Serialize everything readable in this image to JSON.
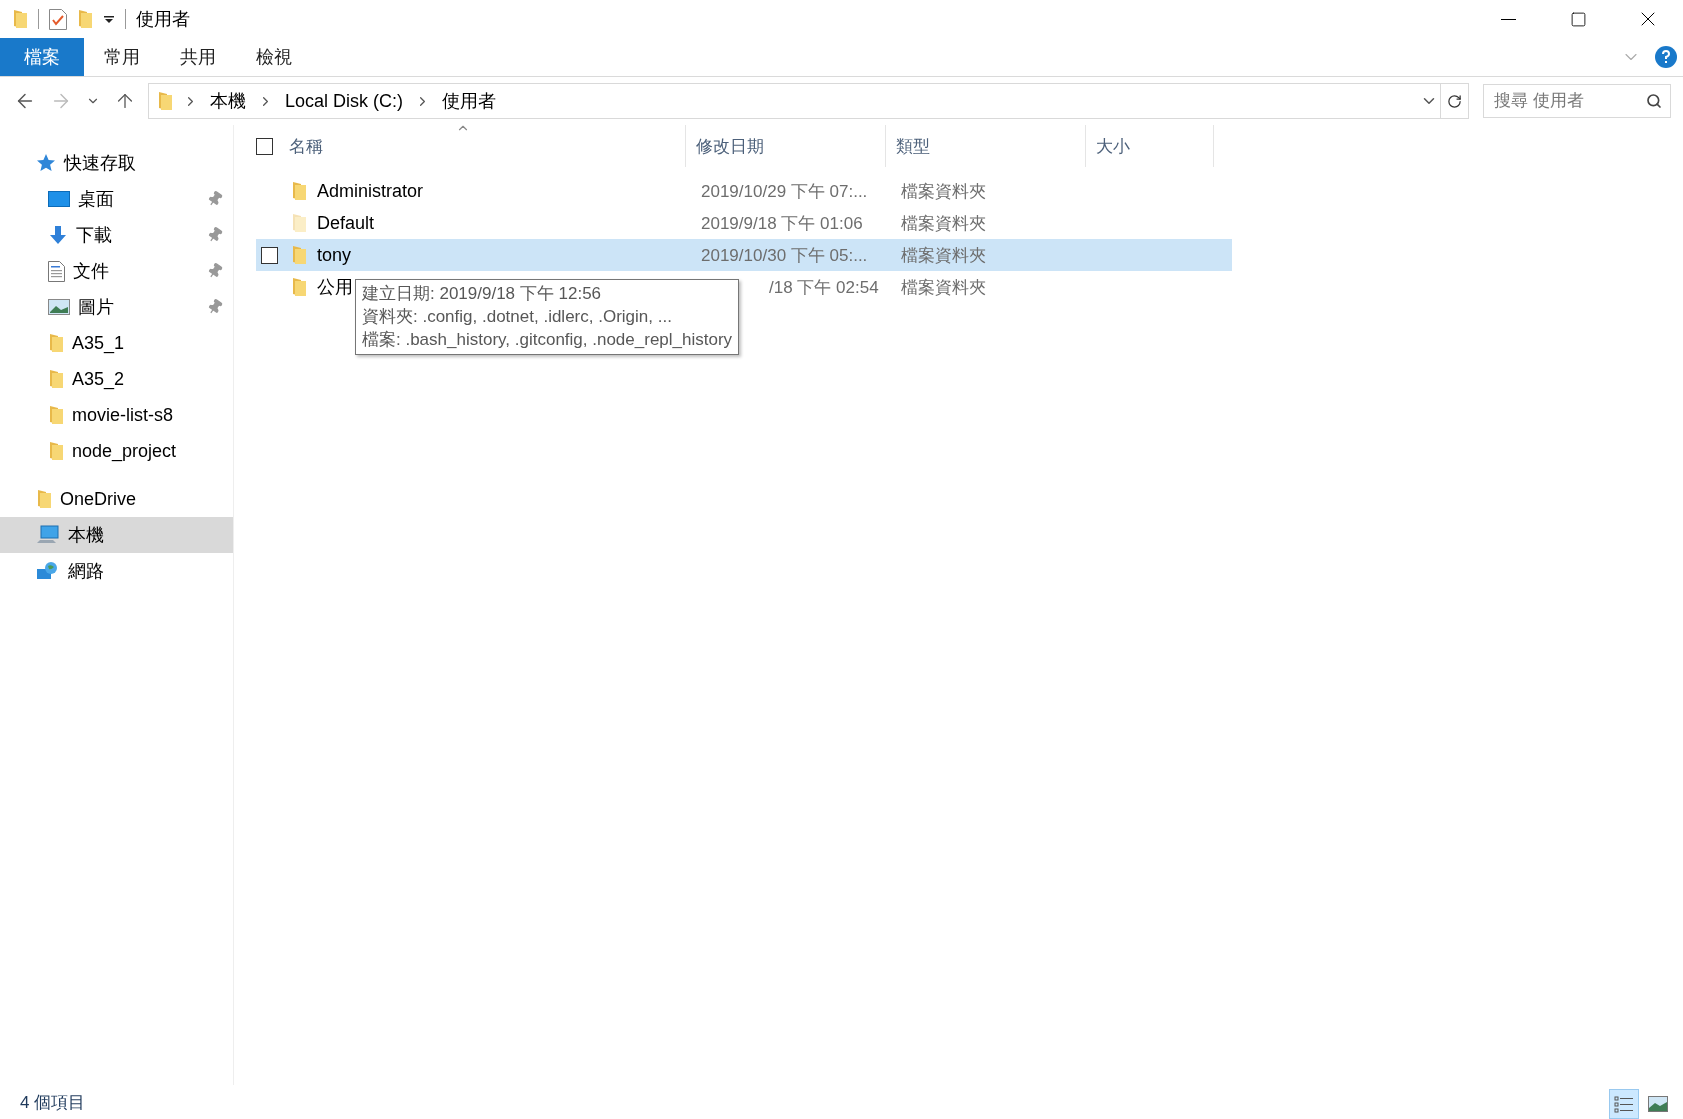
{
  "window": {
    "title": "使用者"
  },
  "ribbon_tabs": [
    {
      "label": "檔案",
      "selected": true
    },
    {
      "label": "常用",
      "selected": false
    },
    {
      "label": "共用",
      "selected": false
    },
    {
      "label": "檢視",
      "selected": false
    }
  ],
  "address": {
    "path": [
      "本機",
      "Local Disk (C:)",
      "使用者"
    ]
  },
  "search": {
    "placeholder": "搜尋 使用者"
  },
  "sidebar": {
    "items": [
      {
        "label": "快速存取",
        "kind": "star",
        "selected": false,
        "children": [
          {
            "label": "桌面",
            "kind": "desktop",
            "pinned": true
          },
          {
            "label": "下載",
            "kind": "download",
            "pinned": true
          },
          {
            "label": "文件",
            "kind": "document",
            "pinned": true
          },
          {
            "label": "圖片",
            "kind": "pictures",
            "pinned": true
          },
          {
            "label": "A35_1",
            "kind": "folder",
            "pinned": false
          },
          {
            "label": "A35_2",
            "kind": "folder",
            "pinned": false
          },
          {
            "label": "movie-list-s8",
            "kind": "folder",
            "pinned": false
          },
          {
            "label": "node_project",
            "kind": "folder",
            "pinned": false
          }
        ]
      },
      {
        "label": "OneDrive",
        "kind": "folder",
        "selected": false
      },
      {
        "label": "本機",
        "kind": "computer",
        "selected": true
      },
      {
        "label": "網路",
        "kind": "network",
        "selected": false
      }
    ]
  },
  "table": {
    "select_all": {
      "checked": false
    },
    "columns": [
      {
        "label": "名稱",
        "sorted": true
      },
      {
        "label": "修改日期",
        "sorted": false
      },
      {
        "label": "類型",
        "sorted": false
      },
      {
        "label": "大小",
        "sorted": false
      }
    ],
    "rows": [
      {
        "name": "Administrator",
        "modified": "2019/10/29 下午 07:...",
        "type": "檔案資料夾",
        "selected": false,
        "hidden": false,
        "under_tooltip": false
      },
      {
        "name": "Default",
        "modified": "2019/9/18 下午 01:06",
        "type": "檔案資料夾",
        "selected": false,
        "hidden": true,
        "under_tooltip": false
      },
      {
        "name": "tony",
        "modified": "2019/10/30 下午 05:...",
        "type": "檔案資料夾",
        "selected": true,
        "hidden": false,
        "under_tooltip": false
      },
      {
        "name": "公用",
        "modified": "/18 下午 02:54",
        "type": "檔案資料夾",
        "selected": false,
        "hidden": false,
        "under_tooltip": true
      }
    ]
  },
  "tooltip": {
    "lines": [
      "建立日期: 2019/9/18 下午 12:56",
      "資料夾: .config, .dotnet, .idlerc, .Origin, ...",
      "檔案: .bash_history, .gitconfig, .node_repl_history"
    ]
  },
  "status_bar": {
    "item_count": "4 個項目"
  },
  "view_buttons": [
    {
      "kind": "details",
      "selected": true
    },
    {
      "kind": "tiles",
      "selected": false
    }
  ]
}
